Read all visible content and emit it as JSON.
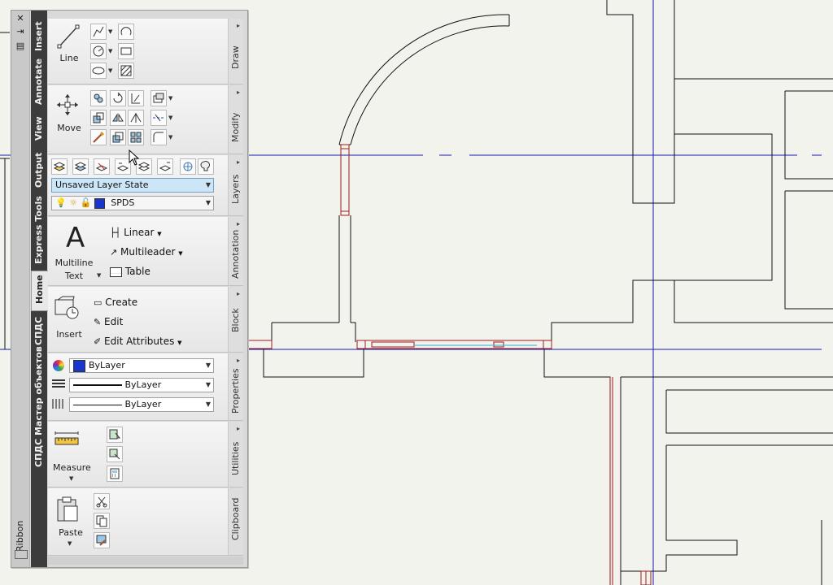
{
  "strip": {
    "close": "✕",
    "pin": "⇥",
    "menu": "▤",
    "title": "Ribbon"
  },
  "tabs": [
    "Insert",
    "Annotate",
    "View",
    "Output",
    "Express Tools",
    "Home",
    "СПДС",
    "СПДС Мастер объектов"
  ],
  "active_tab": "Home",
  "panels": {
    "draw": {
      "title": "Draw",
      "line_label": "Line"
    },
    "modify": {
      "title": "Modify",
      "move_label": "Move"
    },
    "layers": {
      "title": "Layers",
      "layer_state": "Unsaved Layer State",
      "current_layer": "SPDS",
      "layer_color": "#1a35cc"
    },
    "annotation": {
      "title": "Annotation",
      "multiline_1": "Multiline",
      "multiline_2": "Text",
      "linear": "Linear",
      "multileader": "Multileader",
      "table": "Table"
    },
    "block": {
      "title": "Block",
      "insert_label": "Insert",
      "create": "Create",
      "edit": "Edit",
      "edit_attributes": "Edit Attributes"
    },
    "properties": {
      "title": "Properties",
      "color": "ByLayer",
      "linetype": "ByLayer",
      "lineweight": "ByLayer",
      "color_swatch": "#1a35cc"
    },
    "utilities": {
      "title": "Utilities",
      "measure_label": "Measure"
    },
    "clipboard": {
      "title": "Clipboard",
      "paste_label": "Paste"
    }
  },
  "drawing": {
    "wall_color": "#111111",
    "axis_color": "#1b1bb0",
    "red_color": "#9b1b1b"
  }
}
